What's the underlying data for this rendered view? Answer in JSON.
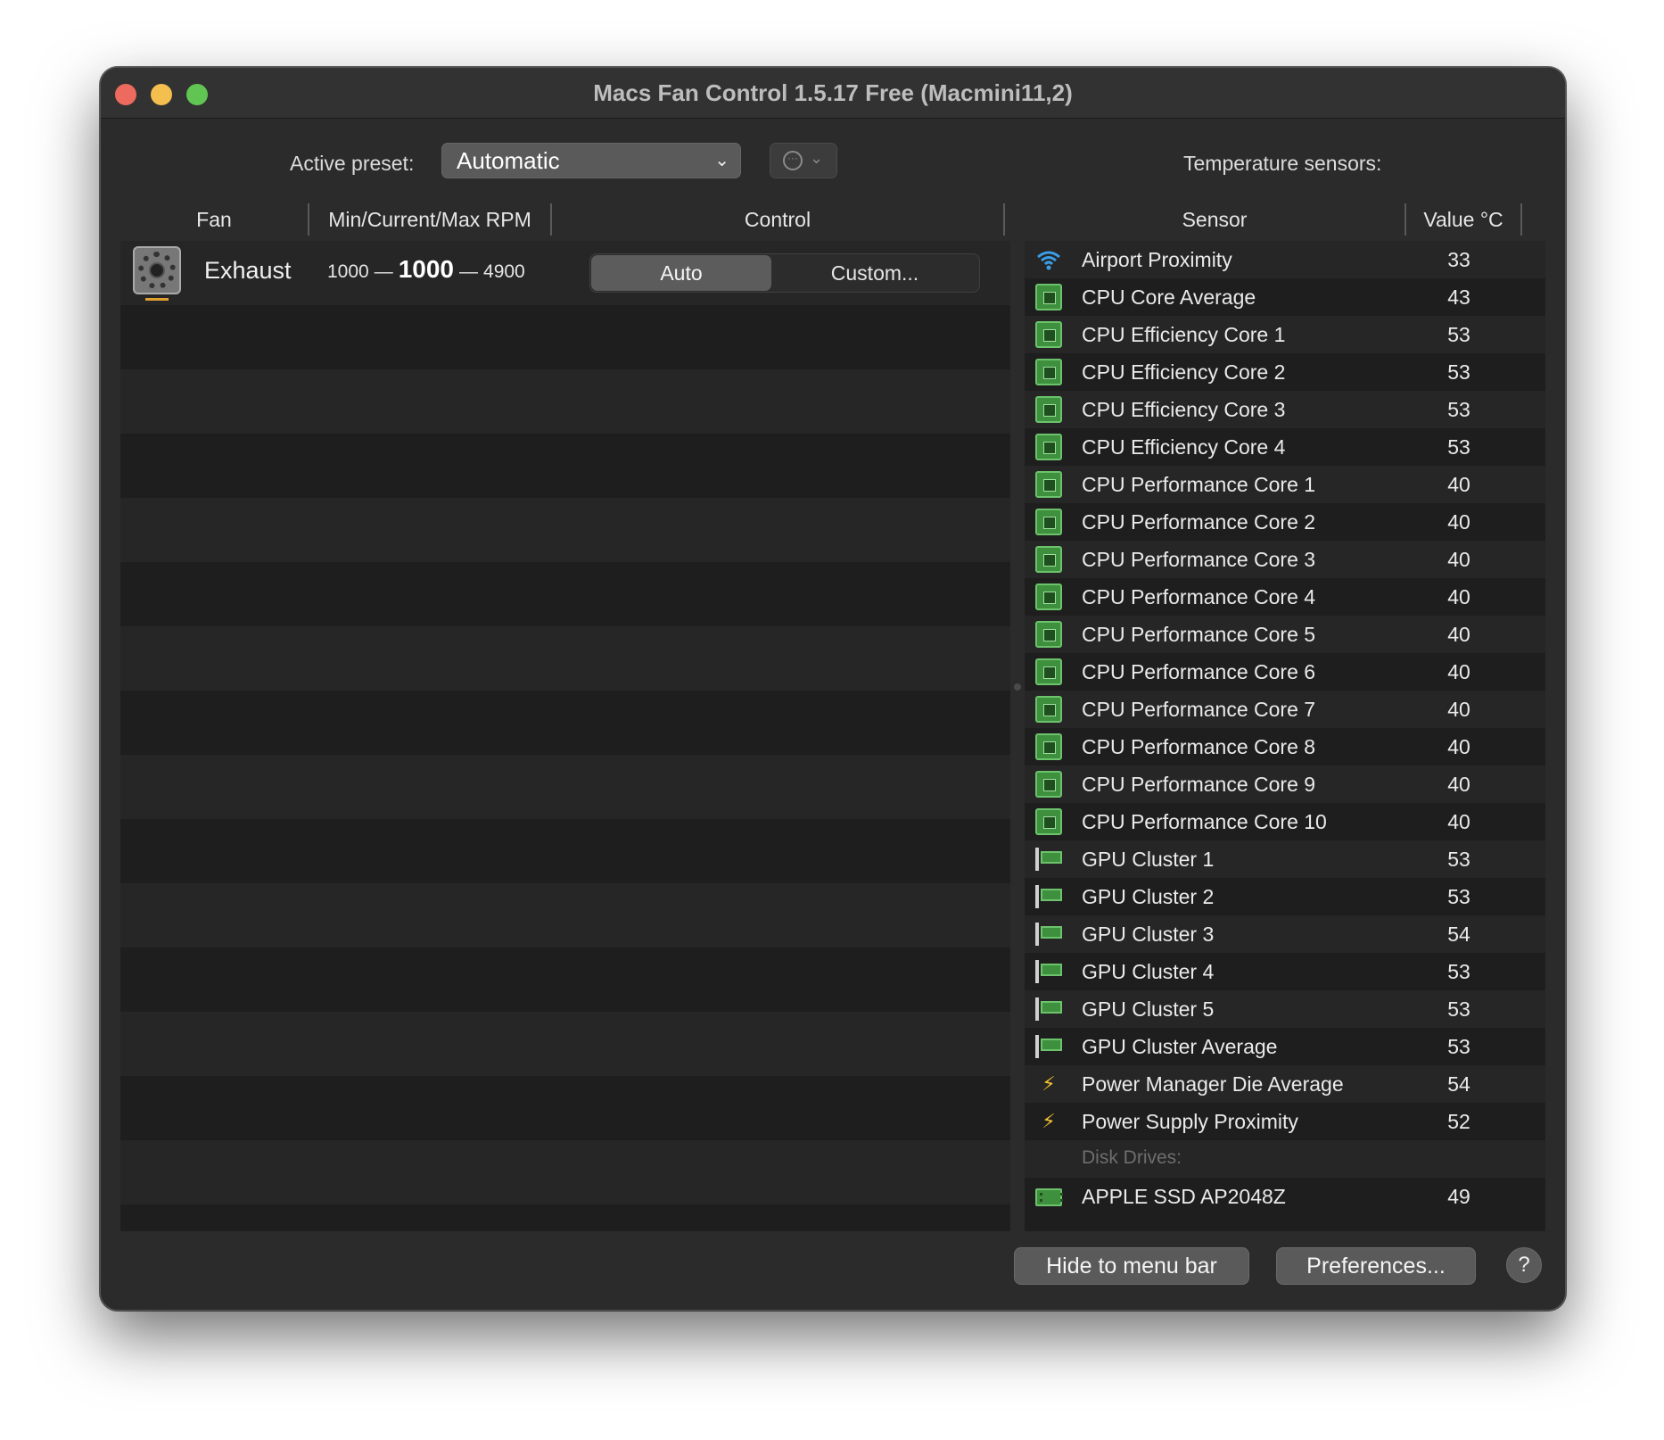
{
  "window": {
    "title": "Macs Fan Control 1.5.17 Free (Macmini11,2)"
  },
  "toolbar": {
    "preset_label": "Active preset:",
    "preset_value": "Automatic",
    "sensors_label": "Temperature sensors:"
  },
  "fan_table": {
    "headers": [
      "Fan",
      "Min/Current/Max RPM",
      "Control"
    ],
    "rows": [
      {
        "name": "Exhaust",
        "min_rpm": "1000",
        "current_rpm": "1000",
        "max_rpm": "4900",
        "control_auto": "Auto",
        "control_custom": "Custom...",
        "selected": "Auto"
      }
    ]
  },
  "sensor_table": {
    "headers": [
      "Sensor",
      "Value °C"
    ],
    "rows": [
      {
        "icon": "wifi-icon",
        "name": "Airport Proximity",
        "value": "33"
      },
      {
        "icon": "cpu-chip-icon",
        "name": "CPU Core Average",
        "value": "43"
      },
      {
        "icon": "cpu-chip-icon",
        "name": "CPU Efficiency Core 1",
        "value": "53"
      },
      {
        "icon": "cpu-chip-icon",
        "name": "CPU Efficiency Core 2",
        "value": "53"
      },
      {
        "icon": "cpu-chip-icon",
        "name": "CPU Efficiency Core 3",
        "value": "53"
      },
      {
        "icon": "cpu-chip-icon",
        "name": "CPU Efficiency Core 4",
        "value": "53"
      },
      {
        "icon": "cpu-chip-icon",
        "name": "CPU Performance Core 1",
        "value": "40"
      },
      {
        "icon": "cpu-chip-icon",
        "name": "CPU Performance Core 2",
        "value": "40"
      },
      {
        "icon": "cpu-chip-icon",
        "name": "CPU Performance Core 3",
        "value": "40"
      },
      {
        "icon": "cpu-chip-icon",
        "name": "CPU Performance Core 4",
        "value": "40"
      },
      {
        "icon": "cpu-chip-icon",
        "name": "CPU Performance Core 5",
        "value": "40"
      },
      {
        "icon": "cpu-chip-icon",
        "name": "CPU Performance Core 6",
        "value": "40"
      },
      {
        "icon": "cpu-chip-icon",
        "name": "CPU Performance Core 7",
        "value": "40"
      },
      {
        "icon": "cpu-chip-icon",
        "name": "CPU Performance Core 8",
        "value": "40"
      },
      {
        "icon": "cpu-chip-icon",
        "name": "CPU Performance Core 9",
        "value": "40"
      },
      {
        "icon": "cpu-chip-icon",
        "name": "CPU Performance Core 10",
        "value": "40"
      },
      {
        "icon": "gpu-card-icon",
        "name": "GPU Cluster 1",
        "value": "53"
      },
      {
        "icon": "gpu-card-icon",
        "name": "GPU Cluster 2",
        "value": "53"
      },
      {
        "icon": "gpu-card-icon",
        "name": "GPU Cluster 3",
        "value": "54"
      },
      {
        "icon": "gpu-card-icon",
        "name": "GPU Cluster 4",
        "value": "53"
      },
      {
        "icon": "gpu-card-icon",
        "name": "GPU Cluster 5",
        "value": "53"
      },
      {
        "icon": "gpu-card-icon",
        "name": "GPU Cluster Average",
        "value": "53"
      },
      {
        "icon": "lightning-bolt-icon",
        "name": "Power Manager Die Average",
        "value": "54"
      },
      {
        "icon": "lightning-bolt-icon",
        "name": "Power Supply Proximity",
        "value": "52"
      },
      {
        "section": true,
        "name": "Disk Drives:"
      },
      {
        "icon": "ssd-drive-icon",
        "name": "APPLE SSD AP2048Z",
        "value": "49"
      }
    ]
  },
  "footer": {
    "hide_button": "Hide to menu bar",
    "prefs_button": "Preferences...",
    "help_button": "?"
  },
  "colors": {
    "window_bg": "#2b2b2b",
    "accent_green": "#3e8f3e",
    "wifi_blue": "#3a9ee8",
    "bolt_yellow": "#f2c230"
  }
}
